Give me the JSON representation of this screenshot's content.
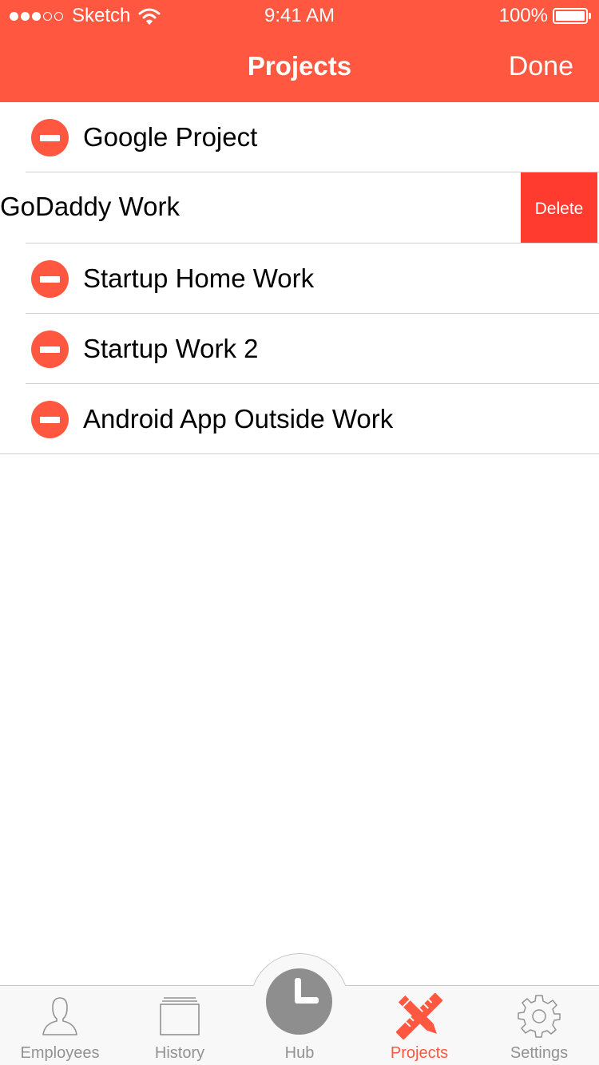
{
  "status_bar": {
    "signal_filled": 3,
    "signal_total": 5,
    "carrier": "Sketch",
    "time": "9:41 AM",
    "battery": "100%"
  },
  "nav": {
    "title": "Projects",
    "done_label": "Done"
  },
  "projects": [
    {
      "name": "Google Project"
    },
    {
      "name": "GoDaddy Work",
      "swiped": true,
      "action_label": "Delete"
    },
    {
      "name": "Startup Home Work"
    },
    {
      "name": "Startup Work 2"
    },
    {
      "name": "Android App Outside Work"
    }
  ],
  "tabs": [
    {
      "label": "Employees",
      "icon": "person-icon"
    },
    {
      "label": "History",
      "icon": "stack-icon"
    },
    {
      "label": "Hub",
      "icon": "clock-icon"
    },
    {
      "label": "Projects",
      "icon": "pencil-ruler-icon",
      "active": true
    },
    {
      "label": "Settings",
      "icon": "gear-icon"
    }
  ],
  "colors": {
    "brand": "#FF5740",
    "delete": "#FF3B30",
    "tab_inactive": "#929292",
    "separator": "#CFCFCF"
  }
}
